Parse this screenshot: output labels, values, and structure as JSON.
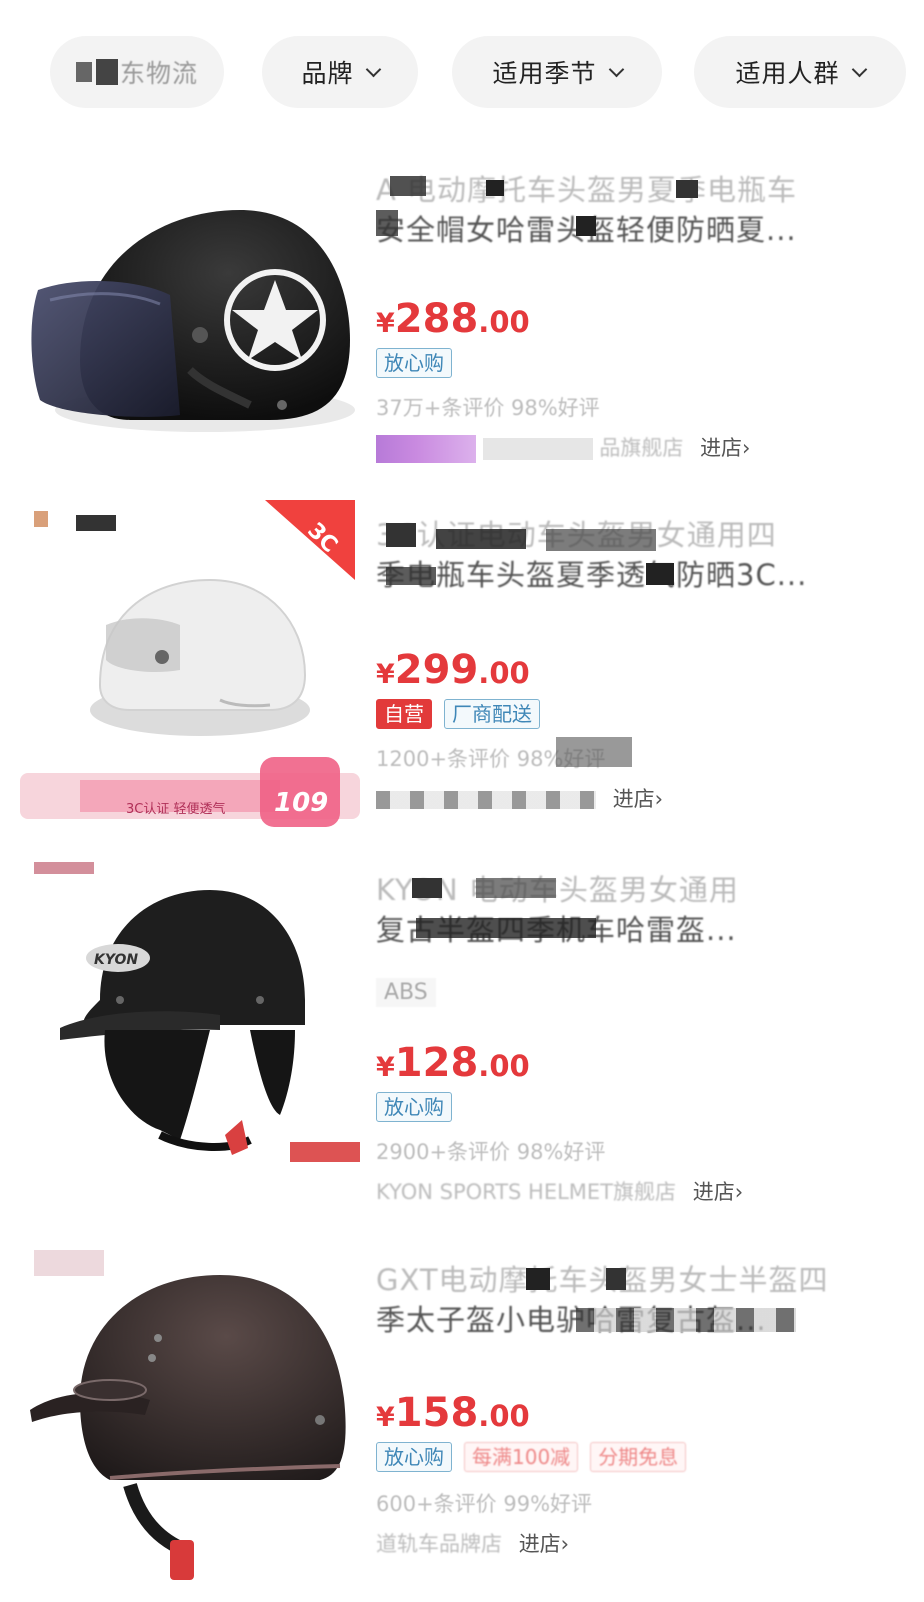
{
  "filters": [
    {
      "label": "东物流",
      "has_dropdown": false
    },
    {
      "label": "品牌",
      "has_dropdown": true
    },
    {
      "label": "适用季节",
      "has_dropdown": true
    },
    {
      "label": "适用人群",
      "has_dropdown": true
    }
  ],
  "products": [
    {
      "title_line1": "A 电动摩托车头盔男夏季电瓶车",
      "title_line2": "安全帽女哈雷头盔轻便防晒夏...",
      "price_symbol": "¥",
      "price_int": "288",
      "price_dec": ".00",
      "badges": [
        "放心购"
      ],
      "reviews": "37万+条评价  98%好评",
      "store": "品旗舰店",
      "enter_store": "进店›"
    },
    {
      "title_line1": "3C认证电动车头盔男女通用四",
      "title_line2": "季电瓶车头盔夏季透气防晒3C...",
      "price_symbol": "¥",
      "price_int": "299",
      "price_dec": ".00",
      "badges": [
        "自营",
        "厂商配送"
      ],
      "reviews": "1200+条评价  98%好评",
      "store": "",
      "enter_store": "进店›",
      "banner_text": "3C认证 轻便透气",
      "banner_price": "109",
      "corner_tag": "3C"
    },
    {
      "title_line1": "KYON 电动车头盔男女通用",
      "title_line2": "复古半盔四季机车哈雷盔...",
      "spec": "ABS",
      "price_symbol": "¥",
      "price_int": "128",
      "price_dec": ".00",
      "badges": [
        "放心购"
      ],
      "reviews": "2900+条评价  98%好评",
      "store": "KYON SPORTS HELMET旗舰店",
      "enter_store": "进店›",
      "helmet_logo": "KYON"
    },
    {
      "title_line1": "GXT电动摩托车头盔男女士半盔四",
      "title_line2": "季太子盔小电驴哈雷复古盔...",
      "price_symbol": "¥",
      "price_int": "158",
      "price_dec": ".00",
      "badges": [
        "放心购",
        "每满100减",
        "分期免息"
      ],
      "reviews": "600+条评价  99%好评",
      "store": "道轨车品牌店",
      "enter_store": "进店›"
    }
  ],
  "colors": {
    "price": "#e4393c",
    "badge_blue": "#3f87b7",
    "self_op_red": "#e23a3a",
    "chip_bg": "#f3f3f3"
  }
}
